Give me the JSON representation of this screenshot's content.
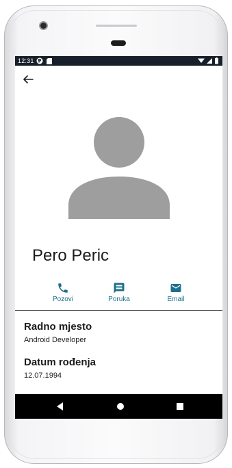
{
  "status_bar": {
    "time": "12:31"
  },
  "toolbar": {
    "back_icon": "arrow-left-icon"
  },
  "profile": {
    "avatar_icon": "person-placeholder-icon",
    "name": "Pero Peric"
  },
  "actions": [
    {
      "label": "Pozovi",
      "icon": "phone-icon"
    },
    {
      "label": "Poruka",
      "icon": "message-icon"
    },
    {
      "label": "Email",
      "icon": "mail-icon"
    }
  ],
  "fields": [
    {
      "label": "Radno mjesto",
      "value": "Android Developer"
    },
    {
      "label": "Datum rođenja",
      "value": "12.07.1994"
    }
  ],
  "colors": {
    "accent": "#1f6f8b",
    "status_bar": "#17202a",
    "avatar": "#9e9e9e"
  }
}
